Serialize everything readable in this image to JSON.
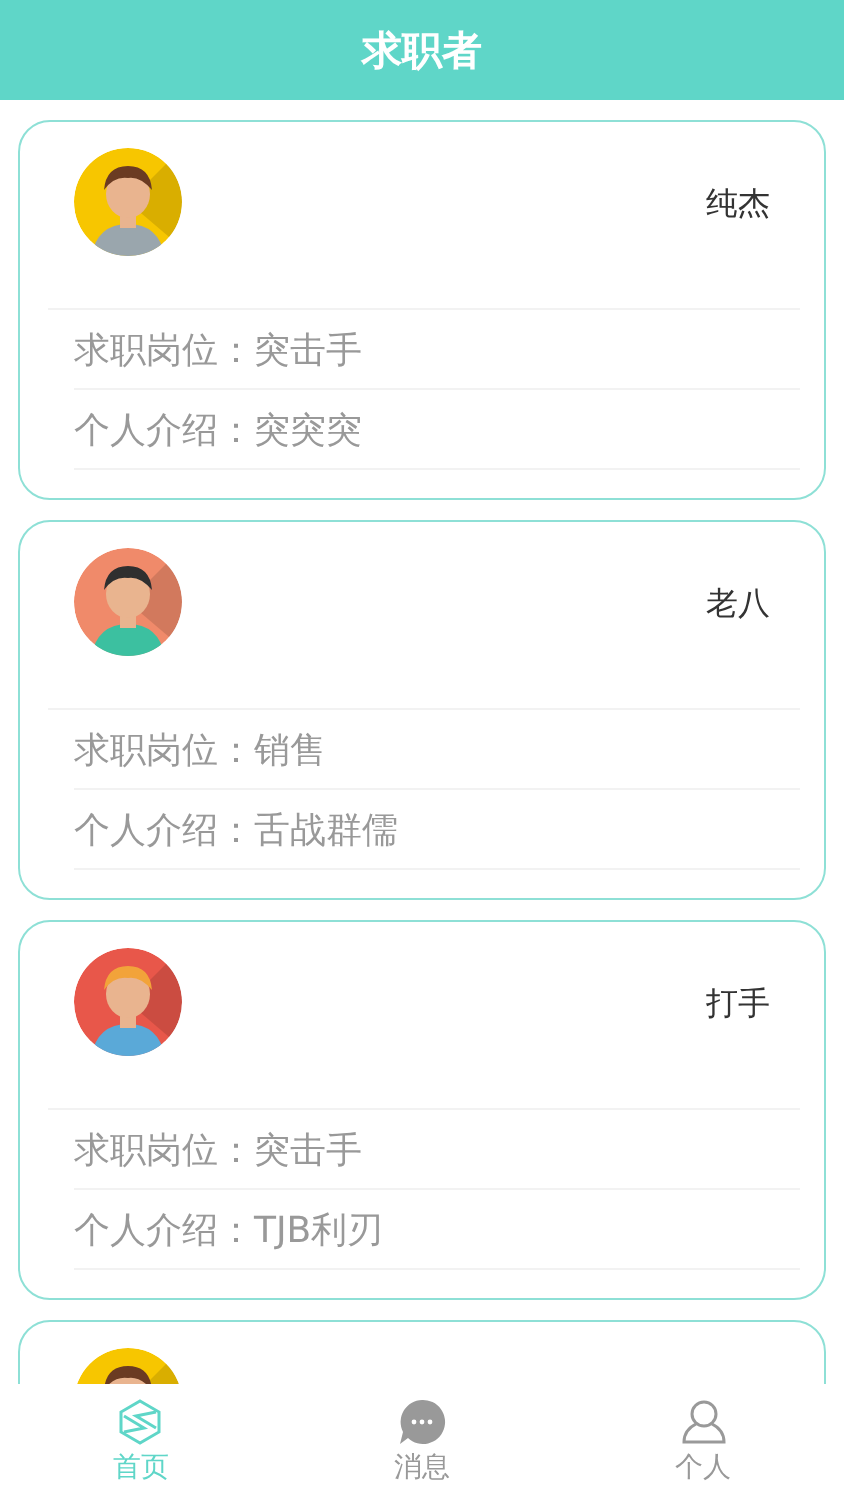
{
  "header": {
    "title": "求职者"
  },
  "cards": [
    {
      "avatar": {
        "kind": "picture"
      },
      "name": "纯杰",
      "fields": [
        {
          "label": "求职岗位：",
          "value": "突击手"
        },
        {
          "label": "个人介绍：",
          "value": "突突突"
        }
      ]
    },
    {
      "avatar": {
        "kind": "picture"
      },
      "name": "老八",
      "fields": [
        {
          "label": "求职岗位：",
          "value": "销售"
        },
        {
          "label": "个人介绍：",
          "value": "舌战群儒"
        }
      ]
    },
    {
      "avatar": {
        "kind": "picture"
      },
      "name": "打手",
      "fields": [
        {
          "label": "求职岗位：",
          "value": "突击手"
        },
        {
          "label": "个人介绍：",
          "value": "TJB利刃"
        }
      ]
    }
  ],
  "partial_card": {
    "avatar": {
      "kind": "picture"
    }
  },
  "tabbar": [
    {
      "label": "首页",
      "kind": "home",
      "selected": true
    },
    {
      "label": "消息",
      "kind": "message",
      "selected": false
    },
    {
      "label": "个人",
      "kind": "person",
      "selected": false
    }
  ]
}
